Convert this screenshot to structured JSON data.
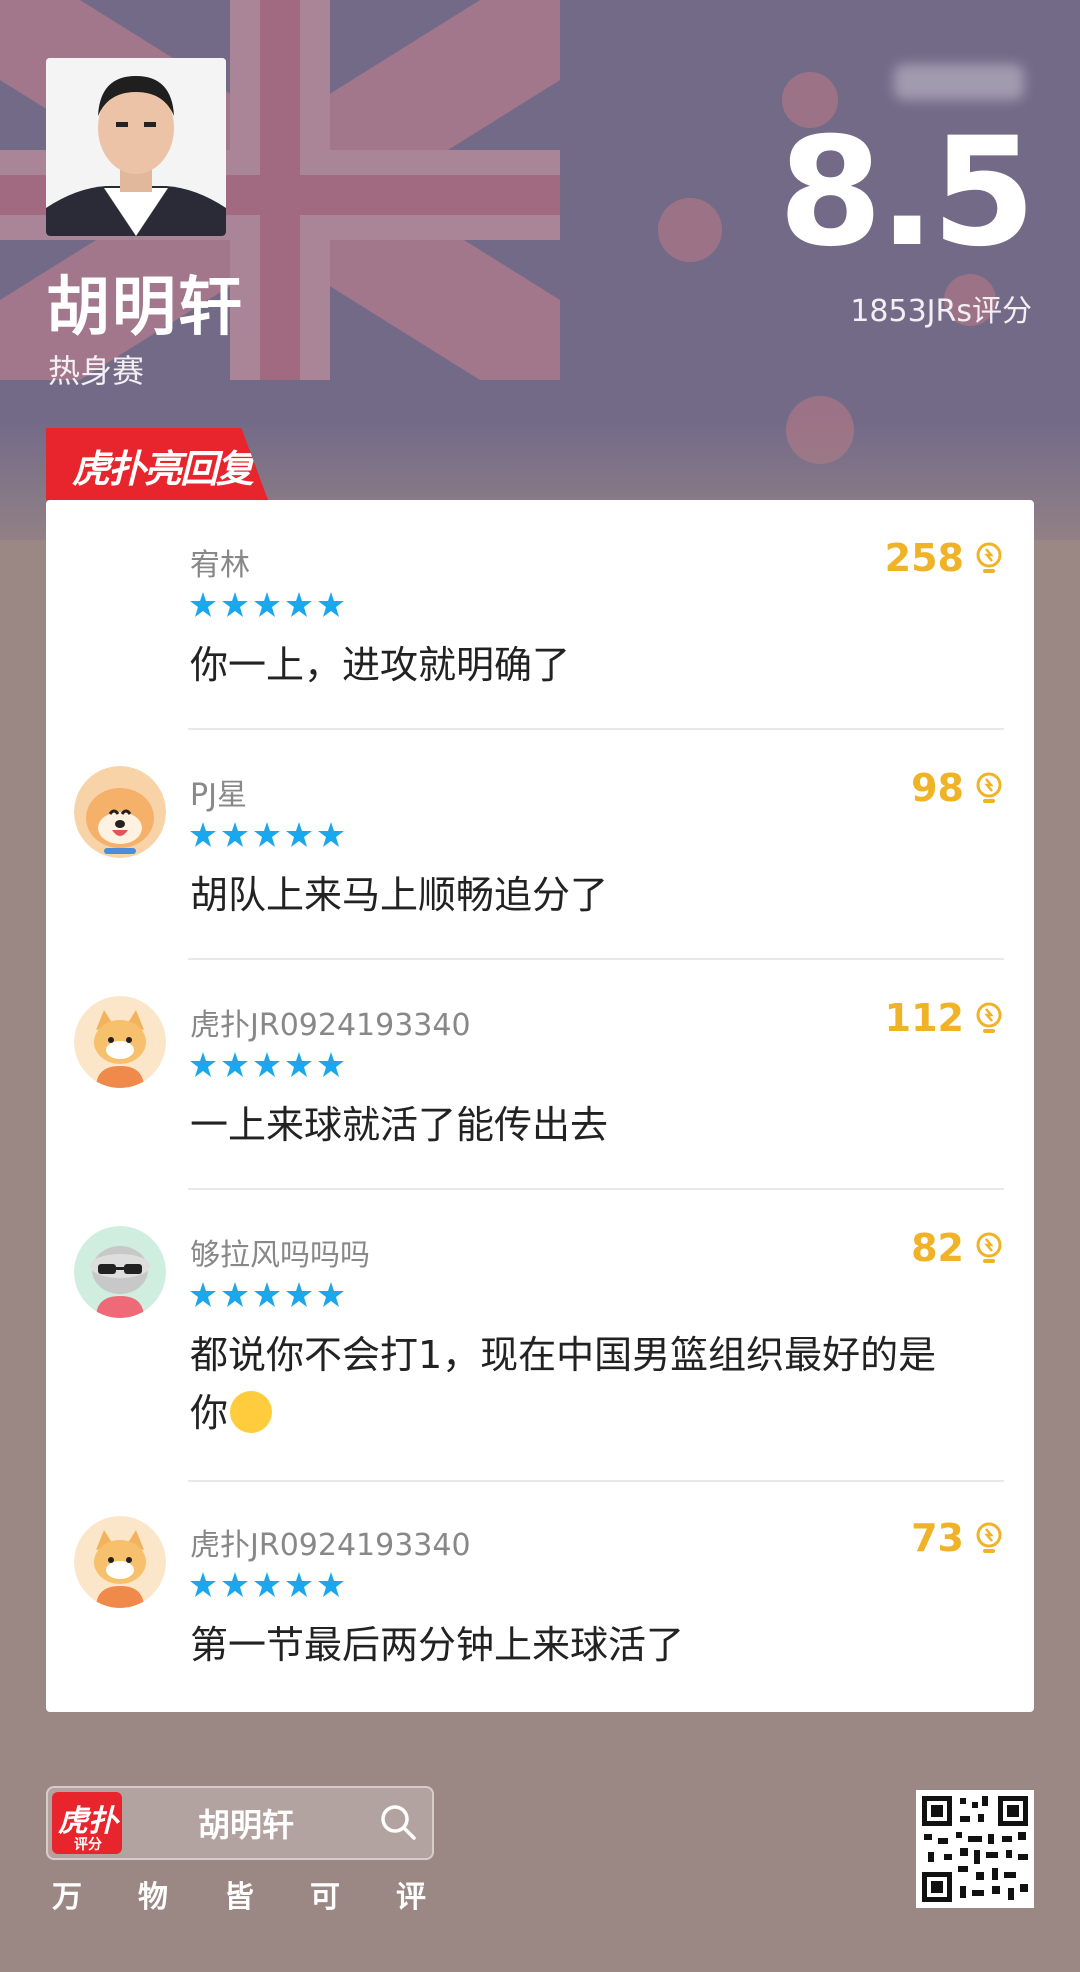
{
  "header": {
    "player_name": "胡明轩",
    "game_type": "热身赛",
    "score": "8.5",
    "rating_count": "1853JRs评分"
  },
  "section_badge": "虎扑亮回复",
  "comments": [
    {
      "user": "宥林",
      "likes": "258",
      "stars": 5,
      "text": "你一上，进攻就明确了"
    },
    {
      "user": "PJ星",
      "likes": "98",
      "stars": 5,
      "text": "胡队上来马上顺畅追分了"
    },
    {
      "user": "虎扑JR0924193340",
      "likes": "112",
      "stars": 5,
      "text": "一上来球就活了能传出去"
    },
    {
      "user": "够拉风吗吗吗",
      "likes": "82",
      "stars": 5,
      "text": "都说你不会打1，现在中国男篮组织最好的是你"
    },
    {
      "user": "虎扑JR0924193340",
      "likes": "73",
      "stars": 5,
      "text": "第一节最后两分钟上来球活了"
    }
  ],
  "footer": {
    "logo_text": "虎扑",
    "logo_sub": "评分",
    "search_text": "胡明轩",
    "slogan": [
      "万",
      "物",
      "皆",
      "可",
      "评"
    ]
  },
  "colors": {
    "accent_red": "#e8242c",
    "likes_gold": "#f0b226",
    "star_blue": "#1aa7ee",
    "background": "#9b8884"
  },
  "icons": [
    "like-bulb-icon",
    "search-icon",
    "star-icon",
    "qr-code"
  ]
}
